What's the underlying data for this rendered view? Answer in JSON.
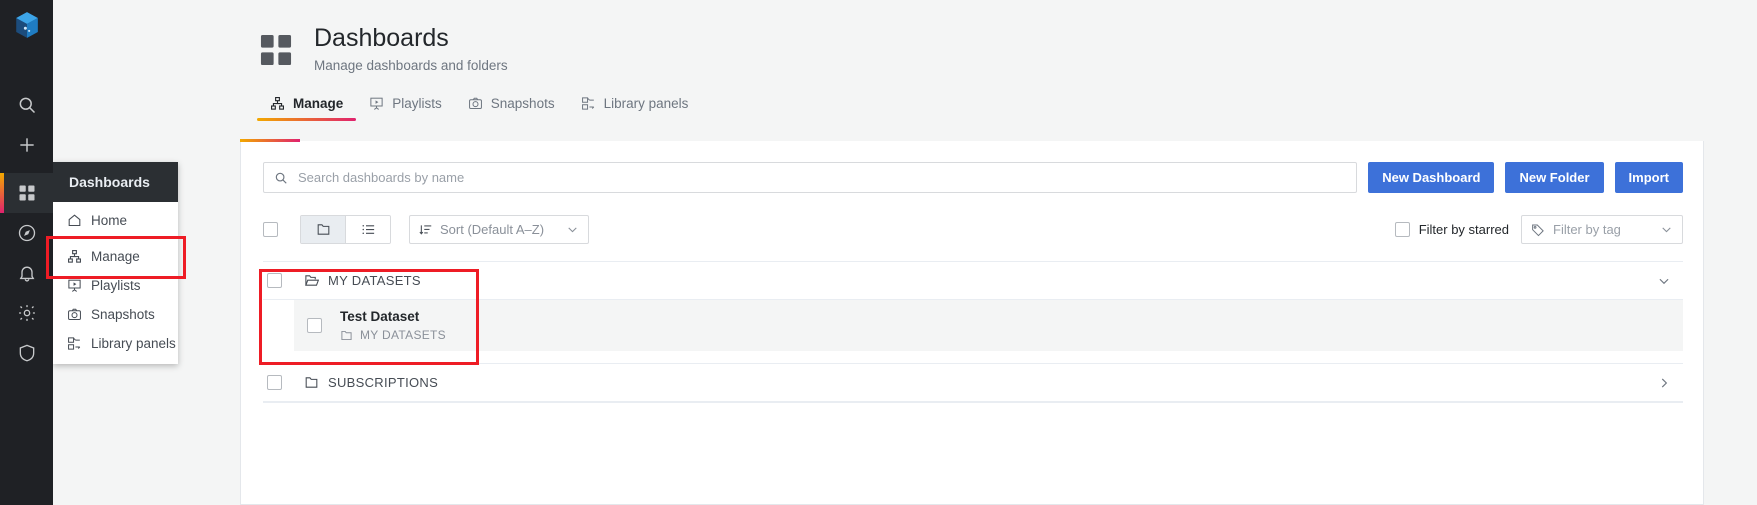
{
  "rail": {
    "logo_icon": "grafana-logo-icon",
    "items": [
      {
        "name": "search-icon",
        "label": "Search"
      },
      {
        "name": "plus-icon",
        "label": "Create"
      },
      {
        "name": "dashboards-icon",
        "label": "Dashboards",
        "active": true
      },
      {
        "name": "compass-icon",
        "label": "Explore"
      },
      {
        "name": "bell-icon",
        "label": "Alerting"
      },
      {
        "name": "gear-icon",
        "label": "Configuration"
      },
      {
        "name": "shield-icon",
        "label": "Server Admin"
      }
    ]
  },
  "megamenu": {
    "title": "Dashboards",
    "items": [
      {
        "label": "Home",
        "icon": "home-icon"
      },
      {
        "label": "Manage",
        "icon": "sitemap-icon",
        "highlighted": true
      },
      {
        "label": "Playlists",
        "icon": "presentation-icon"
      },
      {
        "label": "Snapshots",
        "icon": "camera-icon"
      },
      {
        "label": "Library panels",
        "icon": "library-panels-icon"
      }
    ]
  },
  "page": {
    "icon": "dashboards-grid-icon",
    "title": "Dashboards",
    "subtitle": "Manage dashboards and folders"
  },
  "tabs": [
    {
      "label": "Manage",
      "icon": "sitemap-icon",
      "active": true
    },
    {
      "label": "Playlists",
      "icon": "presentation-icon",
      "active": false
    },
    {
      "label": "Snapshots",
      "icon": "camera-icon",
      "active": false
    },
    {
      "label": "Library panels",
      "icon": "library-panels-icon",
      "active": false
    }
  ],
  "search": {
    "placeholder": "Search dashboards by name",
    "value": "",
    "icon": "search-icon"
  },
  "actions": {
    "new_dashboard": "New Dashboard",
    "new_folder": "New Folder",
    "import": "Import"
  },
  "toolbar": {
    "select_all_checked": false,
    "view_folder_icon": "folder-view-icon",
    "view_list_icon": "list-view-icon",
    "view_mode": "folder",
    "sort_label": "Sort (Default A–Z)",
    "sort_icon": "sort-amount-down-icon",
    "caret_icon": "chevron-down-icon",
    "filter_starred_label": "Filter by starred",
    "filter_starred_checked": false,
    "filter_tag_placeholder": "Filter by tag",
    "filter_tag_icon": "tag-icon"
  },
  "results": [
    {
      "type": "folder",
      "name": "MY DATASETS",
      "icon": "folder-open-icon",
      "expanded": true,
      "chevron": "chevron-down-icon",
      "checked": false,
      "children": [
        {
          "type": "dashboard",
          "title": "Test Dataset",
          "folder": "MY DATASETS",
          "folder_icon": "folder-icon",
          "checked": false
        }
      ]
    },
    {
      "type": "folder",
      "name": "SUBSCRIPTIONS",
      "icon": "folder-icon",
      "expanded": false,
      "chevron": "chevron-right-icon",
      "checked": false,
      "children": []
    }
  ],
  "colors": {
    "accent_gradient_start": "#f2a900",
    "accent_gradient_end": "#e0226e",
    "primary_button": "#3d71d9",
    "highlight_box": "#ee1c25",
    "rail_background": "#1f2125",
    "page_background": "#f4f5f5"
  }
}
